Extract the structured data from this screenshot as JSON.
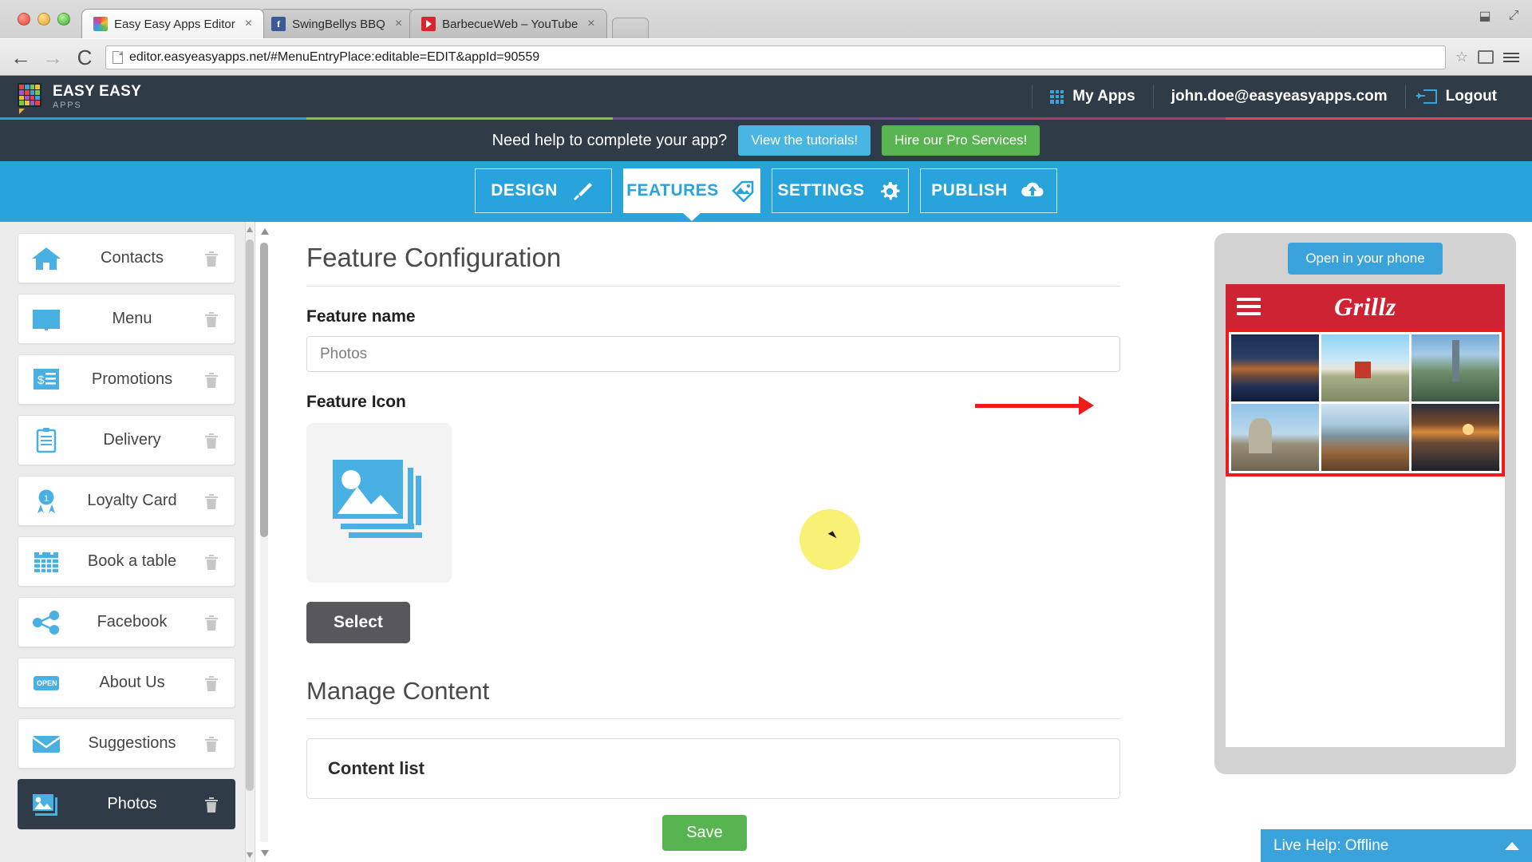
{
  "browser": {
    "tabs": [
      {
        "title": "Easy Easy Apps Editor",
        "favicon": "easyeasy-favicon",
        "active": true
      },
      {
        "title": "SwingBellys BBQ",
        "favicon": "facebook-favicon",
        "active": false
      },
      {
        "title": "BarbecueWeb – YouTube",
        "favicon": "youtube-favicon",
        "active": false
      }
    ],
    "url": "editor.easyeasyapps.net/#MenuEntryPlace:editable=EDIT&appId=90559",
    "back_icon": "back-arrow-icon",
    "forward_icon": "forward-arrow-icon",
    "reload_icon": "reload-icon",
    "bookmark_icon": "star-icon",
    "menu_icon": "hamburger-menu-icon"
  },
  "header": {
    "logo_line1": "EASY EASY",
    "logo_line2": "APPS",
    "my_apps": "My Apps",
    "user_email": "john.doe@easyeasyapps.com",
    "logout": "Logout"
  },
  "rainbow_colors": [
    "#2a9fd6",
    "#7ac943",
    "#6b4f8a",
    "#b5326a",
    "#e8434a"
  ],
  "helpbar": {
    "question": "Need help to complete your app?",
    "tutorials_button": "View the tutorials!",
    "pro_button": "Hire our Pro Services!",
    "tutorials_color": "#48b5e2",
    "pro_color": "#58b451"
  },
  "navtabs": [
    {
      "label": "DESIGN",
      "icon": "brush-icon",
      "active": false
    },
    {
      "label": "FEATURES",
      "icon": "tag-photo-icon",
      "active": true
    },
    {
      "label": "SETTINGS",
      "icon": "gear-icon",
      "active": false
    },
    {
      "label": "PUBLISH",
      "icon": "cloud-upload-icon",
      "active": false
    }
  ],
  "sidebar": {
    "items": [
      {
        "label": "Contacts",
        "icon": "home-icon",
        "selected": false
      },
      {
        "label": "Menu",
        "icon": "book-icon",
        "selected": false
      },
      {
        "label": "Promotions",
        "icon": "receipt-dollar-icon",
        "selected": false
      },
      {
        "label": "Delivery",
        "icon": "clipboard-icon",
        "selected": false
      },
      {
        "label": "Loyalty Card",
        "icon": "award-ribbon-icon",
        "selected": false
      },
      {
        "label": "Book a table",
        "icon": "calendar-icon",
        "selected": false
      },
      {
        "label": "Facebook",
        "icon": "share-nodes-icon",
        "selected": false
      },
      {
        "label": "About Us",
        "icon": "open-sign-icon",
        "selected": false
      },
      {
        "label": "Suggestions",
        "icon": "envelope-icon",
        "selected": false
      },
      {
        "label": "Photos",
        "icon": "photo-stack-icon",
        "selected": true
      }
    ],
    "delete_icon": "trash-icon"
  },
  "main": {
    "panel_title": "Feature Configuration",
    "feature_name_label": "Feature name",
    "feature_name_value": "Photos",
    "feature_name_placeholder": "Photos",
    "feature_icon_label": "Feature Icon",
    "feature_icon": "photo-stack-icon",
    "select_button": "Select",
    "manage_content_title": "Manage Content",
    "content_list_title": "Content list",
    "save_button": "Save",
    "save_color": "#58b451"
  },
  "preview": {
    "open_in_phone": "Open in your phone",
    "app_brand": "Grillz",
    "menu_icon": "hamburger-menu-icon",
    "topbar_color": "#cd2332",
    "highlight_color": "#ee1b1b",
    "thumbnails": [
      "mountain-sunset-thumb",
      "red-barn-snow-thumb",
      "lake-tower-thumb",
      "rock-formation-thumb",
      "coastline-thumb",
      "beach-sunset-thumb"
    ]
  },
  "livehelp": {
    "label": "Live Help: Offline",
    "chevron": "chevron-up-icon",
    "color": "#3ba3dc"
  }
}
